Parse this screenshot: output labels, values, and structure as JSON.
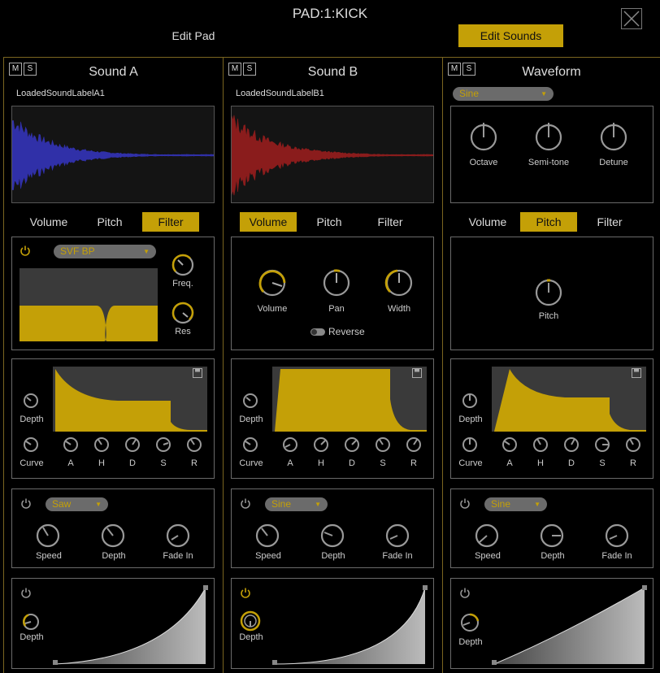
{
  "header": {
    "title": "PAD:1:KICK",
    "edit_pad": "Edit Pad",
    "edit_sounds": "Edit Sounds"
  },
  "colors": {
    "accent": "#c4a007",
    "sound_a_wave": "#3030a8",
    "sound_b_wave": "#8a1c1c"
  },
  "columns": [
    {
      "title": "Sound A",
      "m": "M",
      "s": "S",
      "loaded": "LoadedSoundLabelA1",
      "tabs": [
        "Volume",
        "Pitch",
        "Filter"
      ],
      "active_tab": "Filter",
      "filter": {
        "type": "SVF BP",
        "freq_label": "Freq.",
        "res_label": "Res"
      },
      "env": {
        "depth": "Depth",
        "curve": "Curve",
        "a": "A",
        "h": "H",
        "d": "D",
        "s": "S",
        "r": "R"
      },
      "lfo": {
        "shape": "Saw",
        "speed": "Speed",
        "depth": "Depth",
        "fade_in": "Fade In"
      },
      "vel": {
        "depth": "Depth"
      }
    },
    {
      "title": "Sound B",
      "m": "M",
      "s": "S",
      "loaded": "LoadedSoundLabelB1",
      "tabs": [
        "Volume",
        "Pitch",
        "Filter"
      ],
      "active_tab": "Volume",
      "volume": {
        "volume": "Volume",
        "pan": "Pan",
        "width": "Width",
        "reverse": "Reverse"
      },
      "env": {
        "depth": "Depth",
        "curve": "Curve",
        "a": "A",
        "h": "H",
        "d": "D",
        "s": "S",
        "r": "R"
      },
      "lfo": {
        "shape": "Sine",
        "speed": "Speed",
        "depth": "Depth",
        "fade_in": "Fade In"
      },
      "vel": {
        "depth": "Depth"
      }
    },
    {
      "title": "Waveform",
      "m": "M",
      "s": "S",
      "waveform": "Sine",
      "osc": {
        "octave": "Octave",
        "semitone": "Semi-tone",
        "detune": "Detune"
      },
      "tabs": [
        "Volume",
        "Pitch",
        "Filter"
      ],
      "active_tab": "Pitch",
      "pitch": {
        "pitch": "Pitch"
      },
      "env": {
        "depth": "Depth",
        "curve": "Curve",
        "a": "A",
        "h": "H",
        "d": "D",
        "s": "S",
        "r": "R"
      },
      "lfo": {
        "shape": "Sine",
        "speed": "Speed",
        "depth": "Depth",
        "fade_in": "Fade In"
      },
      "vel": {
        "depth": "Depth"
      }
    }
  ]
}
